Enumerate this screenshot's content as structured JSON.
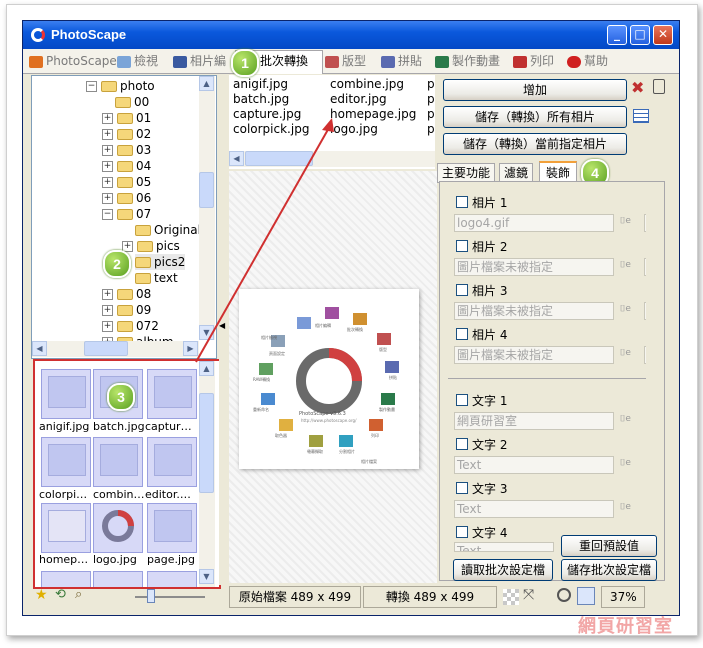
{
  "window": {
    "title": "PhotoScape"
  },
  "tabs": [
    {
      "label": "PhotoScape",
      "color": "#e07020"
    },
    {
      "label": "檢視",
      "color": "#7aa4d8"
    },
    {
      "label": "相片編",
      "color": "#3a5aa0"
    },
    {
      "label": "批次轉換",
      "color": "#7a7a7a"
    },
    {
      "label": "版型",
      "color": "#c05050"
    },
    {
      "label": "拼貼",
      "color": "#5a6ab0"
    },
    {
      "label": "製作動畫",
      "color": "#2a7a4a"
    },
    {
      "label": "列印",
      "color": "#c03030"
    },
    {
      "label": "幫助",
      "color": "#d02020"
    }
  ],
  "tree": {
    "root": "photo",
    "items": [
      "00",
      "01",
      "02",
      "03",
      "04",
      "05",
      "06",
      "07",
      "Original",
      "pics",
      "pics2",
      "text",
      "08",
      "09",
      "072",
      "album"
    ]
  },
  "thumbnails": [
    "anigif.jpg",
    "batch.jpg",
    "captur…",
    "colorpi…",
    "combin…",
    "editor.…",
    "homep…",
    "logo.jpg",
    "page.jpg"
  ],
  "file_list": {
    "col1": [
      "anigif.jpg",
      "batch.jpg",
      "capture.jpg",
      "colorpick.jpg"
    ],
    "col2": [
      "combine.jpg",
      "editor.jpg",
      "homepage.jpg",
      "logo.jpg"
    ],
    "col3": [
      "p",
      "p",
      "p",
      "p"
    ]
  },
  "badges": [
    "1",
    "2",
    "3",
    "4"
  ],
  "preview": {
    "logo_text": "PhotoScape v3.6.3",
    "logo_url": "http://www.photoscape.org/",
    "menu_items": [
      "相片檢視",
      "相片編輯",
      "批次轉換",
      "版型",
      "拼貼",
      "製作動畫",
      "列印",
      "分割相片",
      "螢幕擷取",
      "取色器",
      "重新命名",
      "RAW轉換",
      "頁面設定",
      "相片檔案"
    ]
  },
  "right": {
    "add_button": "增加",
    "save_all_button": "儲存（轉換）所有相片",
    "save_current_button": "儲存（轉換）當前指定相片",
    "subtabs": [
      "主要功能",
      "濾鏡",
      "裝飾"
    ],
    "photos": [
      {
        "label": "相片 1",
        "value": "logo4.gif"
      },
      {
        "label": "相片 2",
        "value": "圖片檔案未被指定"
      },
      {
        "label": "相片 3",
        "value": "圖片檔案未被指定"
      },
      {
        "label": "相片 4",
        "value": "圖片檔案未被指定"
      }
    ],
    "texts": [
      {
        "label": "文字 1",
        "value": "網頁研習室"
      },
      {
        "label": "文字 2",
        "value": "Text"
      },
      {
        "label": "文字 3",
        "value": "Text"
      },
      {
        "label": "文字 4",
        "value": "Text"
      }
    ],
    "reset_button": "重回預設值",
    "load_button": "讀取批次設定檔",
    "save_settings_button": "儲存批次設定檔"
  },
  "status": {
    "original": "原始檔案 489 x 499",
    "converted": "轉換 489 x 499",
    "zoom": "37%"
  },
  "watermark": "網頁研習室"
}
